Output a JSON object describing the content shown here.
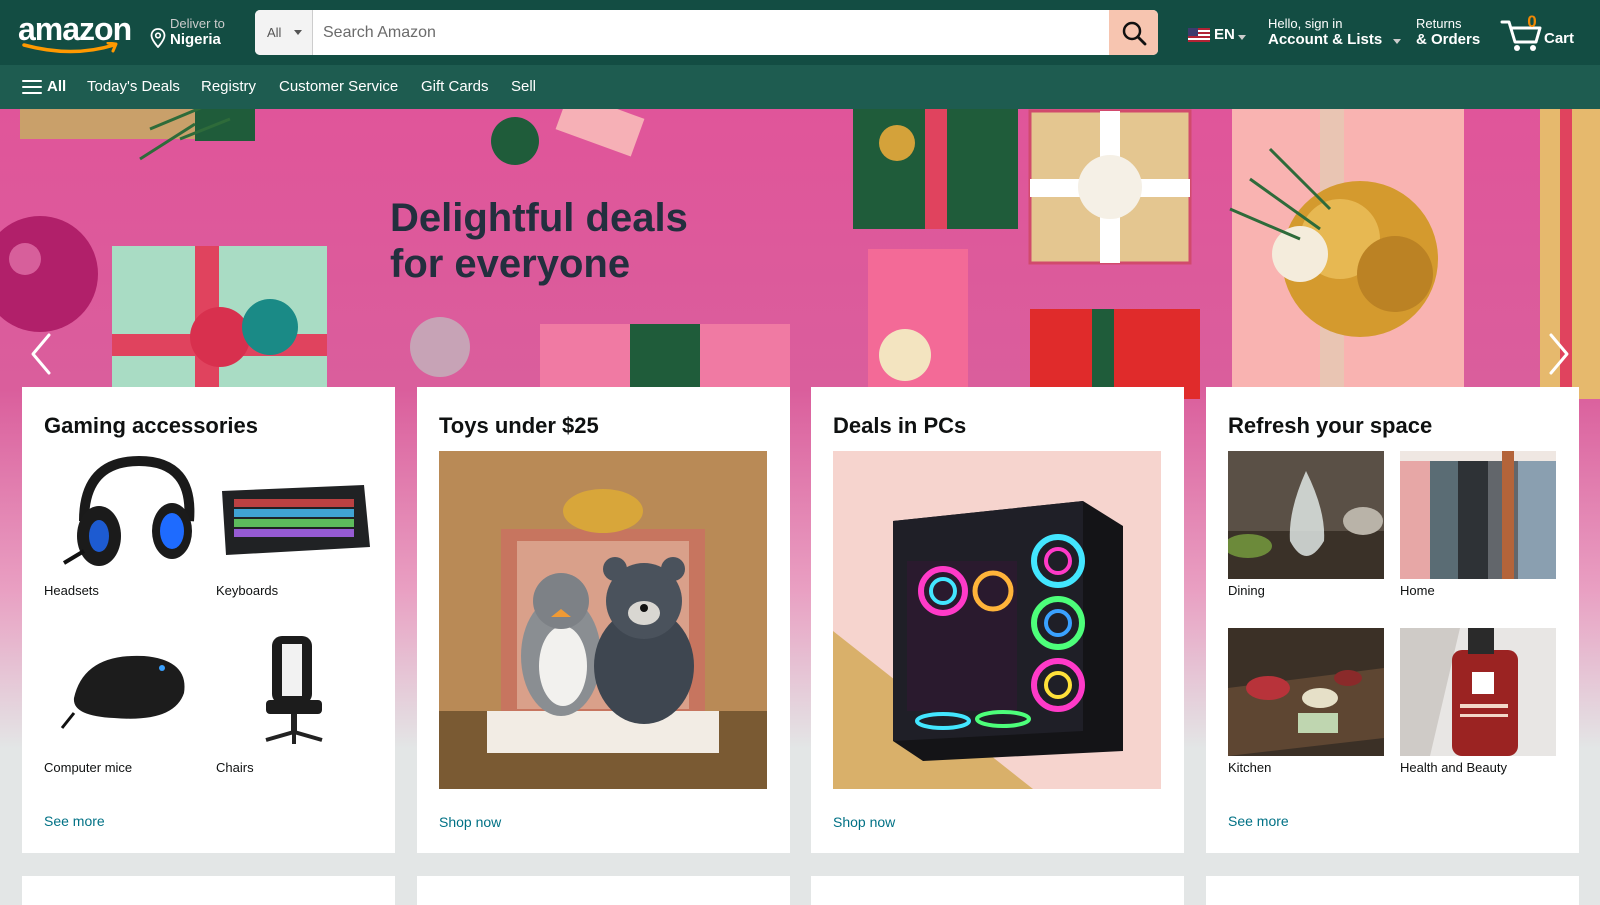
{
  "header": {
    "logo_text": "amazon",
    "deliver_label": "Deliver to",
    "deliver_location": "Nigeria",
    "search_category": "All",
    "search_placeholder": "Search Amazon",
    "language": "EN",
    "account_greeting": "Hello, sign in",
    "account_label": "Account & Lists",
    "returns_label": "Returns",
    "orders_label": "& Orders",
    "cart_count": "0",
    "cart_label": "Cart",
    "colors": {
      "bar": "#134d43",
      "subbar": "#1e5c50",
      "search_button": "#f7c5b0",
      "cart_count": "#f08804"
    }
  },
  "subnav": {
    "all_label": "All",
    "items": [
      "Today's Deals",
      "Registry",
      "Customer Service",
      "Gift Cards",
      "Sell"
    ]
  },
  "hero": {
    "headline_line1": "Delightful deals",
    "headline_line2": "for everyone",
    "prev_icon": "chevron-left-icon",
    "next_icon": "chevron-right-icon",
    "background_color": "#e0559a"
  },
  "cards": [
    {
      "title": "Gaming accessories",
      "tiles": [
        "Headsets",
        "Keyboards",
        "Computer mice",
        "Chairs"
      ],
      "link": "See more"
    },
    {
      "title": "Toys under $25",
      "link": "Shop now"
    },
    {
      "title": "Deals in PCs",
      "link": "Shop now"
    },
    {
      "title": "Refresh your space",
      "tiles": [
        "Dining",
        "Home",
        "Kitchen",
        "Health and Beauty"
      ],
      "link": "See more"
    }
  ]
}
